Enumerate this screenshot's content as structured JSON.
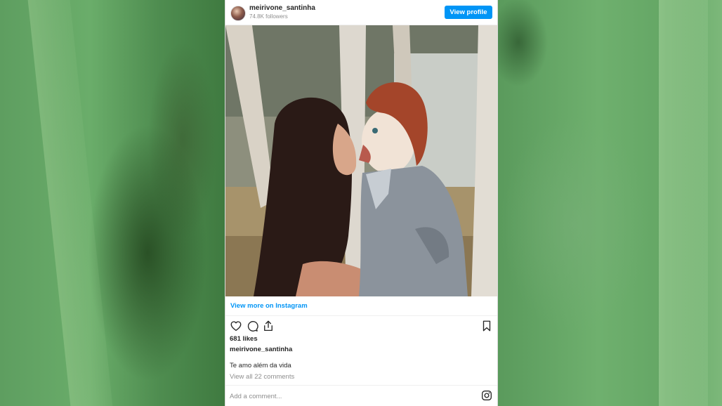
{
  "post": {
    "username": "meirivone_santinha",
    "followers": "74.8K followers",
    "view_profile_label": "View profile",
    "view_more_label": "View more on Instagram",
    "likes": "681 likes",
    "caption_username": "meirivone_santinha",
    "caption": "Te amo além da vida",
    "view_comments": "View all 22 comments",
    "comment_placeholder": "Add a comment..."
  },
  "icons": {
    "like": "heart-icon",
    "comment": "comment-bubble-icon",
    "share": "share-icon",
    "save": "bookmark-icon",
    "brand": "instagram-logo-icon"
  },
  "colors": {
    "accent": "#0095f6",
    "text": "#262626",
    "muted": "#8e8e8e",
    "backdrop_tint": "#5c9a5f"
  }
}
